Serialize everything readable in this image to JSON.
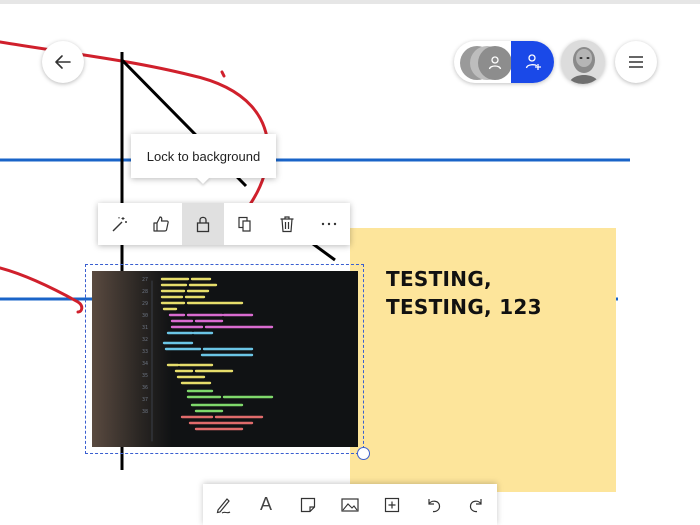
{
  "tooltip": {
    "text": "Lock to background"
  },
  "sticky_note": {
    "line1": "TESTING,",
    "line2": "TESTING, 123",
    "color": "#fde59b"
  },
  "bottom_toolbar": {
    "text_tool_glyph": "A"
  },
  "context_toolbar": {
    "icons": [
      "magic-wand-icon",
      "thumbs-up-icon",
      "lock-icon",
      "copy-icon",
      "delete-icon",
      "more-icon"
    ],
    "active": "lock-icon"
  },
  "colors": {
    "accent": "#1a49e8",
    "ink_red": "#d0202c",
    "ink_blue": "#1a64c8",
    "ink_black": "#000000"
  }
}
